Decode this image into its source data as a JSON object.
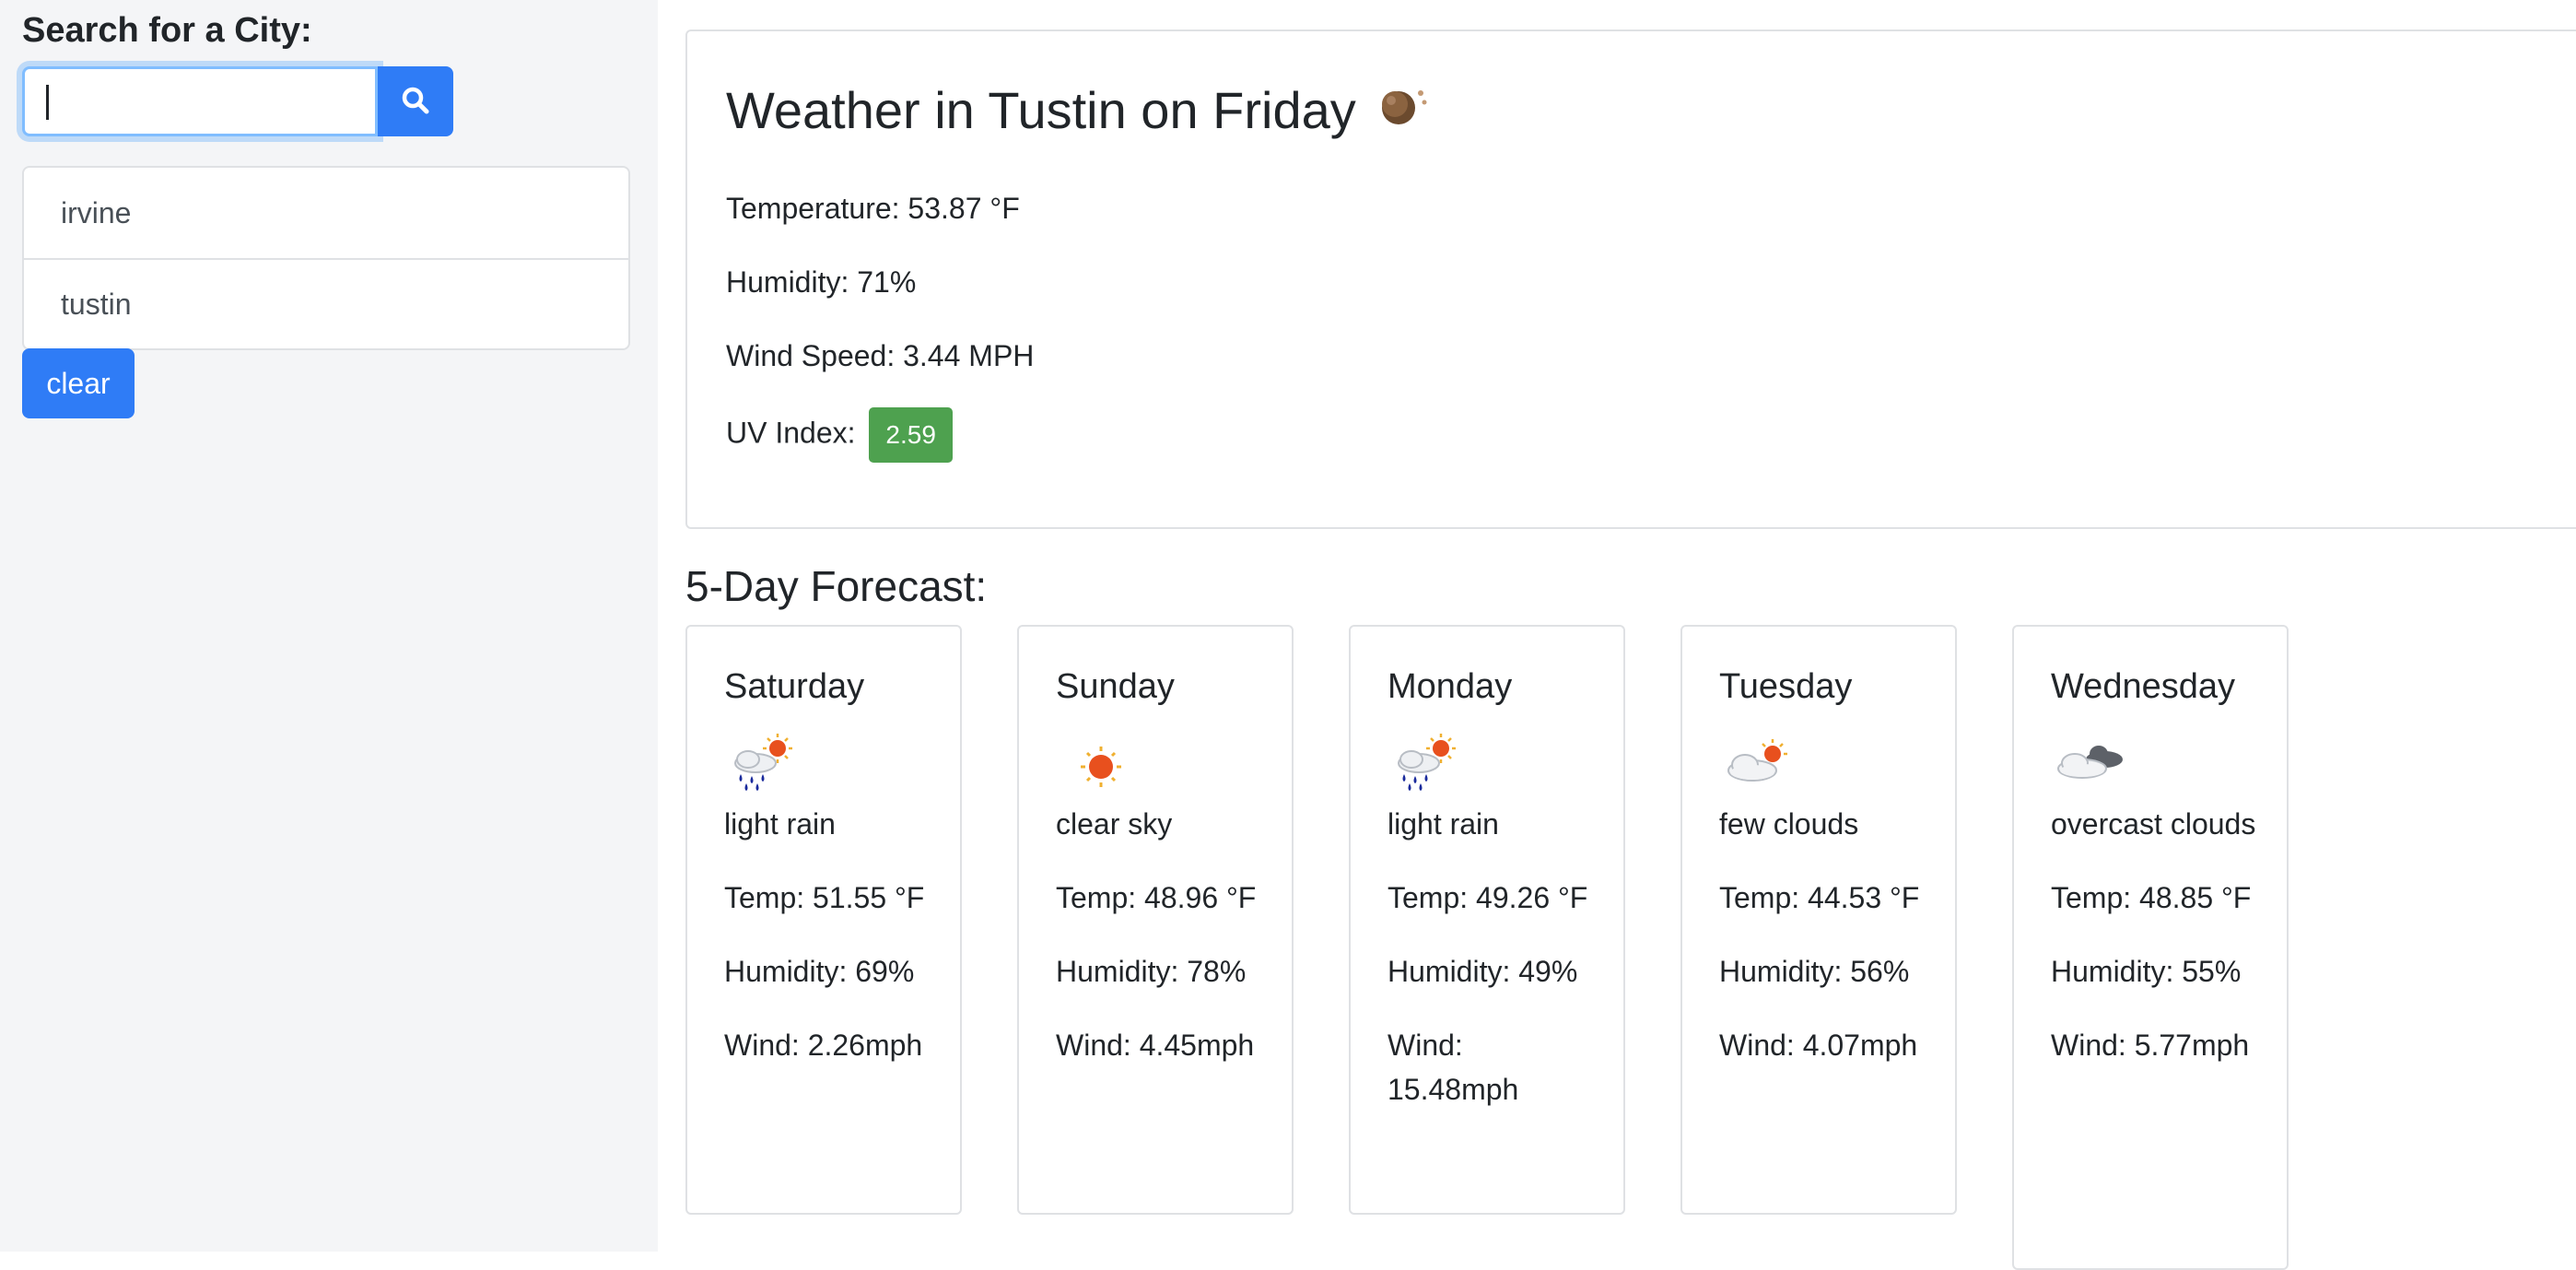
{
  "sidebar": {
    "heading": "Search for a City:",
    "search_value": "",
    "search_icon": "search-icon",
    "history": [
      {
        "label": "irvine"
      },
      {
        "label": "tustin"
      }
    ],
    "clear_label": "clear"
  },
  "current": {
    "title": "Weather in Tustin on Friday",
    "icon": "rainy-night-icon",
    "temperature": "Temperature: 53.87 °F",
    "humidity": "Humidity: 71%",
    "wind": "Wind Speed: 3.44 MPH",
    "uv_label": "UV Index:",
    "uv_value": "2.59",
    "uv_color": "#4ea14f"
  },
  "forecast": {
    "heading": "5-Day Forecast:",
    "days": [
      {
        "day": "Saturday",
        "icon": "light-rain-sun-icon",
        "desc": "light rain",
        "temp": "Temp: 51.55 °F",
        "humidity": "Humidity: 69%",
        "wind": "Wind: 2.26mph"
      },
      {
        "day": "Sunday",
        "icon": "sun-icon",
        "desc": "clear sky",
        "temp": "Temp: 48.96 °F",
        "humidity": "Humidity: 78%",
        "wind": "Wind: 4.45mph"
      },
      {
        "day": "Monday",
        "icon": "light-rain-sun-icon",
        "desc": "light rain",
        "temp": "Temp: 49.26 °F",
        "humidity": "Humidity: 49%",
        "wind": "Wind: 15.48mph"
      },
      {
        "day": "Tuesday",
        "icon": "few-clouds-icon",
        "desc": "few clouds",
        "temp": "Temp: 44.53 °F",
        "humidity": "Humidity: 56%",
        "wind": "Wind: 4.07mph"
      },
      {
        "day": "Wednesday",
        "icon": "overcast-clouds-icon",
        "desc": "overcast clouds",
        "temp": "Temp: 48.85 °F",
        "humidity": "Humidity: 55%",
        "wind": "Wind: 5.77mph"
      }
    ]
  },
  "colors": {
    "primary": "#2f7cf6",
    "sidebar_bg": "#f4f5f7",
    "border": "#dfe1e4"
  }
}
